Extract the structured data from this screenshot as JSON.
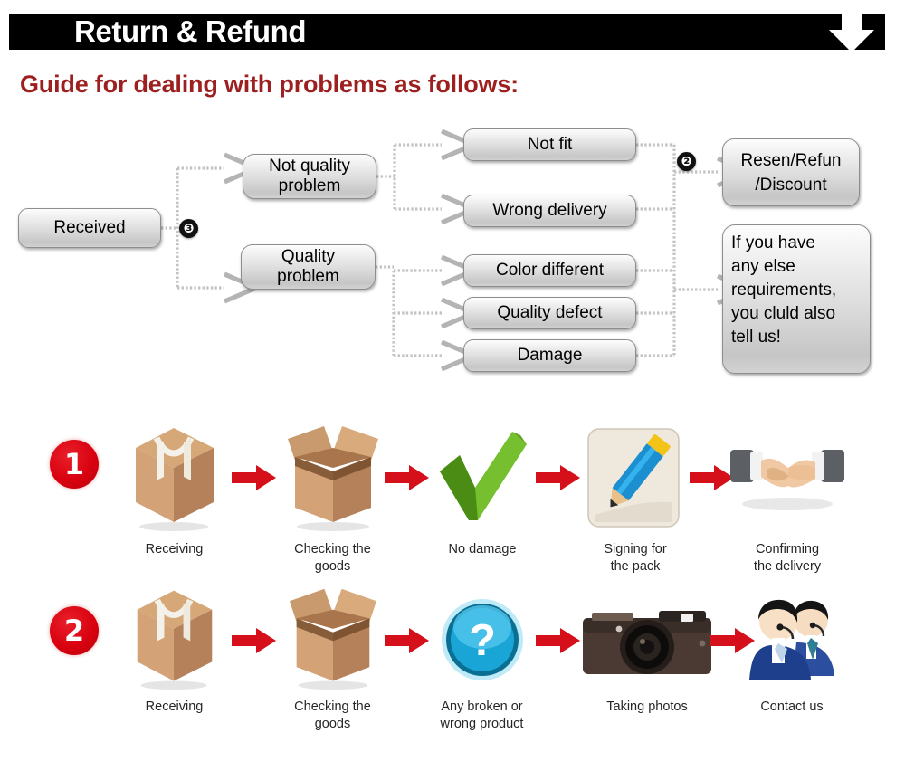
{
  "header": {
    "title": "Return & Refund",
    "arrow_icon": "down-arrow-icon",
    "bar_color": "#000000",
    "title_color": "#ffffff"
  },
  "guide": {
    "heading": "Guide for dealing with problems as follows:",
    "heading_color": "#9d1f1f"
  },
  "flowchart": {
    "start": {
      "label": "Received"
    },
    "branch_badge": "❸",
    "merge_badge": "❷",
    "categories": [
      {
        "label": "Not quality\nproblem",
        "line1": "Not quality",
        "line2": "problem"
      },
      {
        "label": "Quality\nproblem",
        "line1": "Quality",
        "line2": "problem"
      }
    ],
    "issues": [
      {
        "label": "Not fit",
        "category": "Not quality problem"
      },
      {
        "label": "Wrong delivery",
        "category": "Not quality problem"
      },
      {
        "label": "Color different",
        "category": "Quality problem"
      },
      {
        "label": "Quality defect",
        "category": "Quality problem"
      },
      {
        "label": "Damage",
        "category": "Quality problem"
      }
    ],
    "outcomes": [
      {
        "line1": "Resen/Refun",
        "line2": "/Discount"
      }
    ],
    "note": {
      "line1": "If you have",
      "line2": "any else",
      "line3": "requirements,",
      "line4": "you cluld also",
      "line5": "tell us!"
    }
  },
  "process_rows": [
    {
      "number": "1",
      "steps": [
        {
          "icon": "sealed-box-icon",
          "caption_line1": "Receiving",
          "caption_line2": ""
        },
        {
          "icon": "open-box-icon",
          "caption_line1": "Checking the",
          "caption_line2": "goods"
        },
        {
          "icon": "green-check-icon",
          "caption_line1": "No damage",
          "caption_line2": ""
        },
        {
          "icon": "pencil-sign-icon",
          "caption_line1": "Signing for",
          "caption_line2": "the pack"
        },
        {
          "icon": "handshake-icon",
          "caption_line1": "Confirming",
          "caption_line2": "the delivery"
        }
      ],
      "separator_icon": "red-arrow-icon"
    },
    {
      "number": "2",
      "steps": [
        {
          "icon": "sealed-box-icon",
          "caption_line1": "Receiving",
          "caption_line2": ""
        },
        {
          "icon": "open-box-icon",
          "caption_line1": "Checking the",
          "caption_line2": "goods"
        },
        {
          "icon": "blue-question-icon",
          "caption_line1": "Any broken or",
          "caption_line2": "wrong product"
        },
        {
          "icon": "camera-icon",
          "caption_line1": "Taking photos",
          "caption_line2": ""
        },
        {
          "icon": "support-agents-icon",
          "caption_line1": "Contact us",
          "caption_line2": ""
        }
      ],
      "separator_icon": "red-arrow-icon"
    }
  ],
  "colors": {
    "red_accent": "#d8000f",
    "dark_red_heading": "#9d1f1f",
    "black_bar": "#000000",
    "node_border": "#8d8d8d",
    "connector": "#b9b9b9"
  }
}
